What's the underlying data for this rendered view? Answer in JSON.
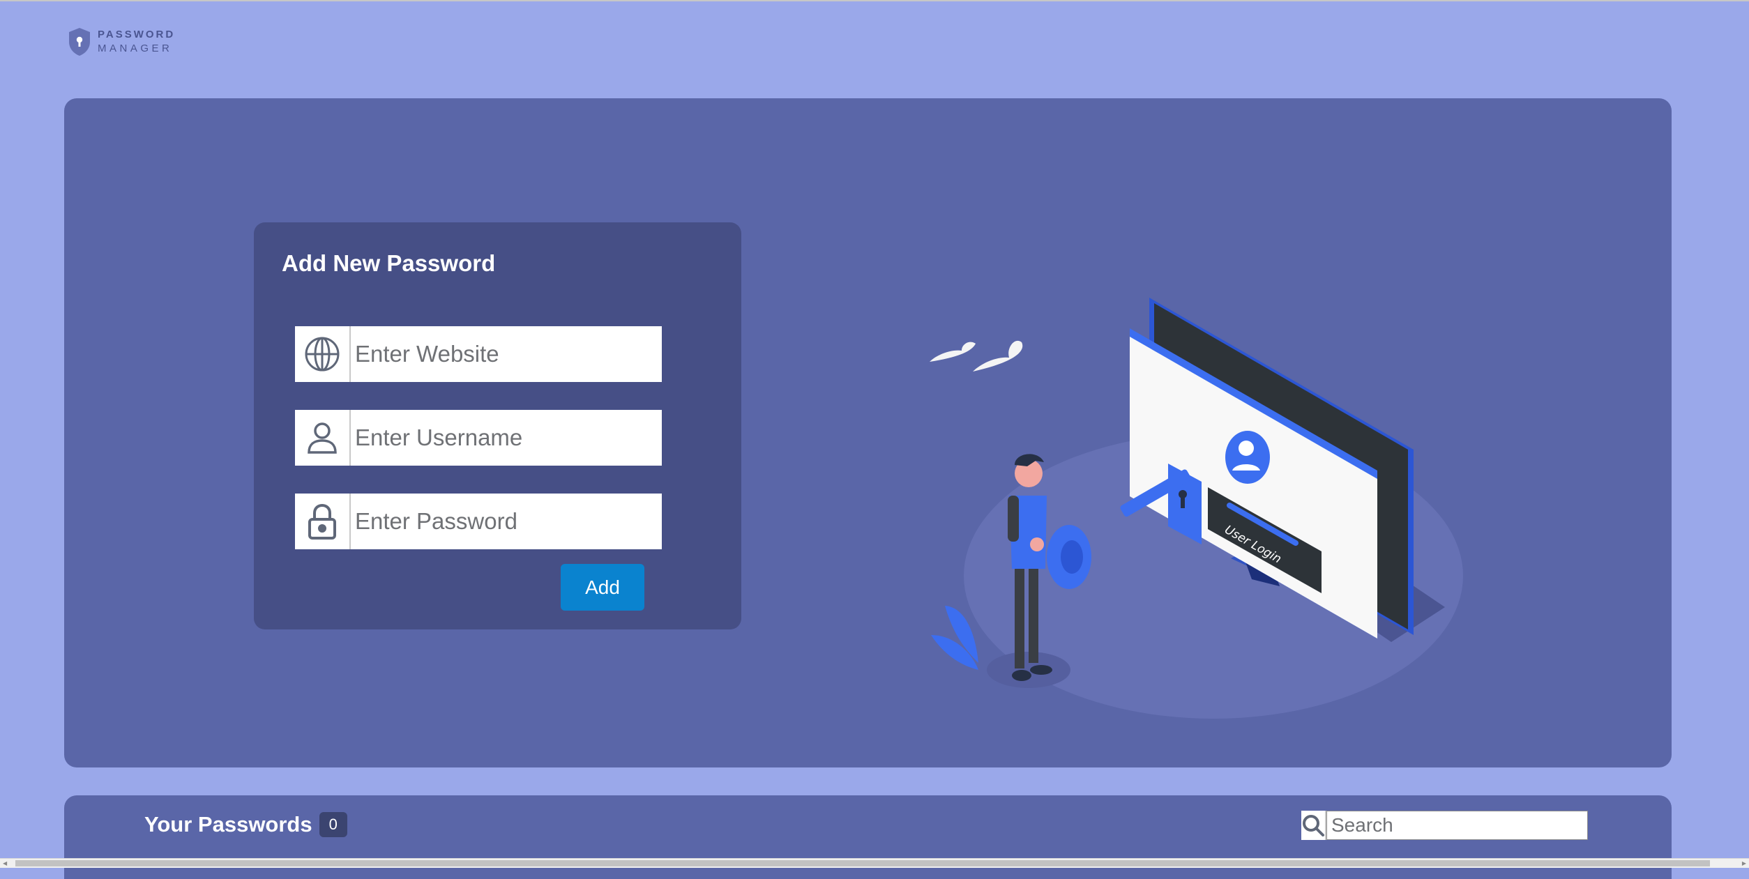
{
  "logo": {
    "line1": "PASSWORD",
    "line2": "MANAGER",
    "icon": "shield-keyhole-icon"
  },
  "form": {
    "title": "Add New Password",
    "website_placeholder": "Enter Website",
    "username_placeholder": "Enter Username",
    "password_placeholder": "Enter Password",
    "add_label": "Add",
    "icons": [
      "globe-icon",
      "user-icon",
      "lock-icon"
    ]
  },
  "illustration": {
    "screen_text": "User Login"
  },
  "passwords": {
    "title": "Your Passwords",
    "count": "0",
    "search_placeholder": "Search"
  },
  "colors": {
    "page_bg": "#9aa8ea",
    "panel": "#5a66a8",
    "card": "#464f86",
    "button": "#0a83cf",
    "accent_blue": "#3c6ef0"
  }
}
